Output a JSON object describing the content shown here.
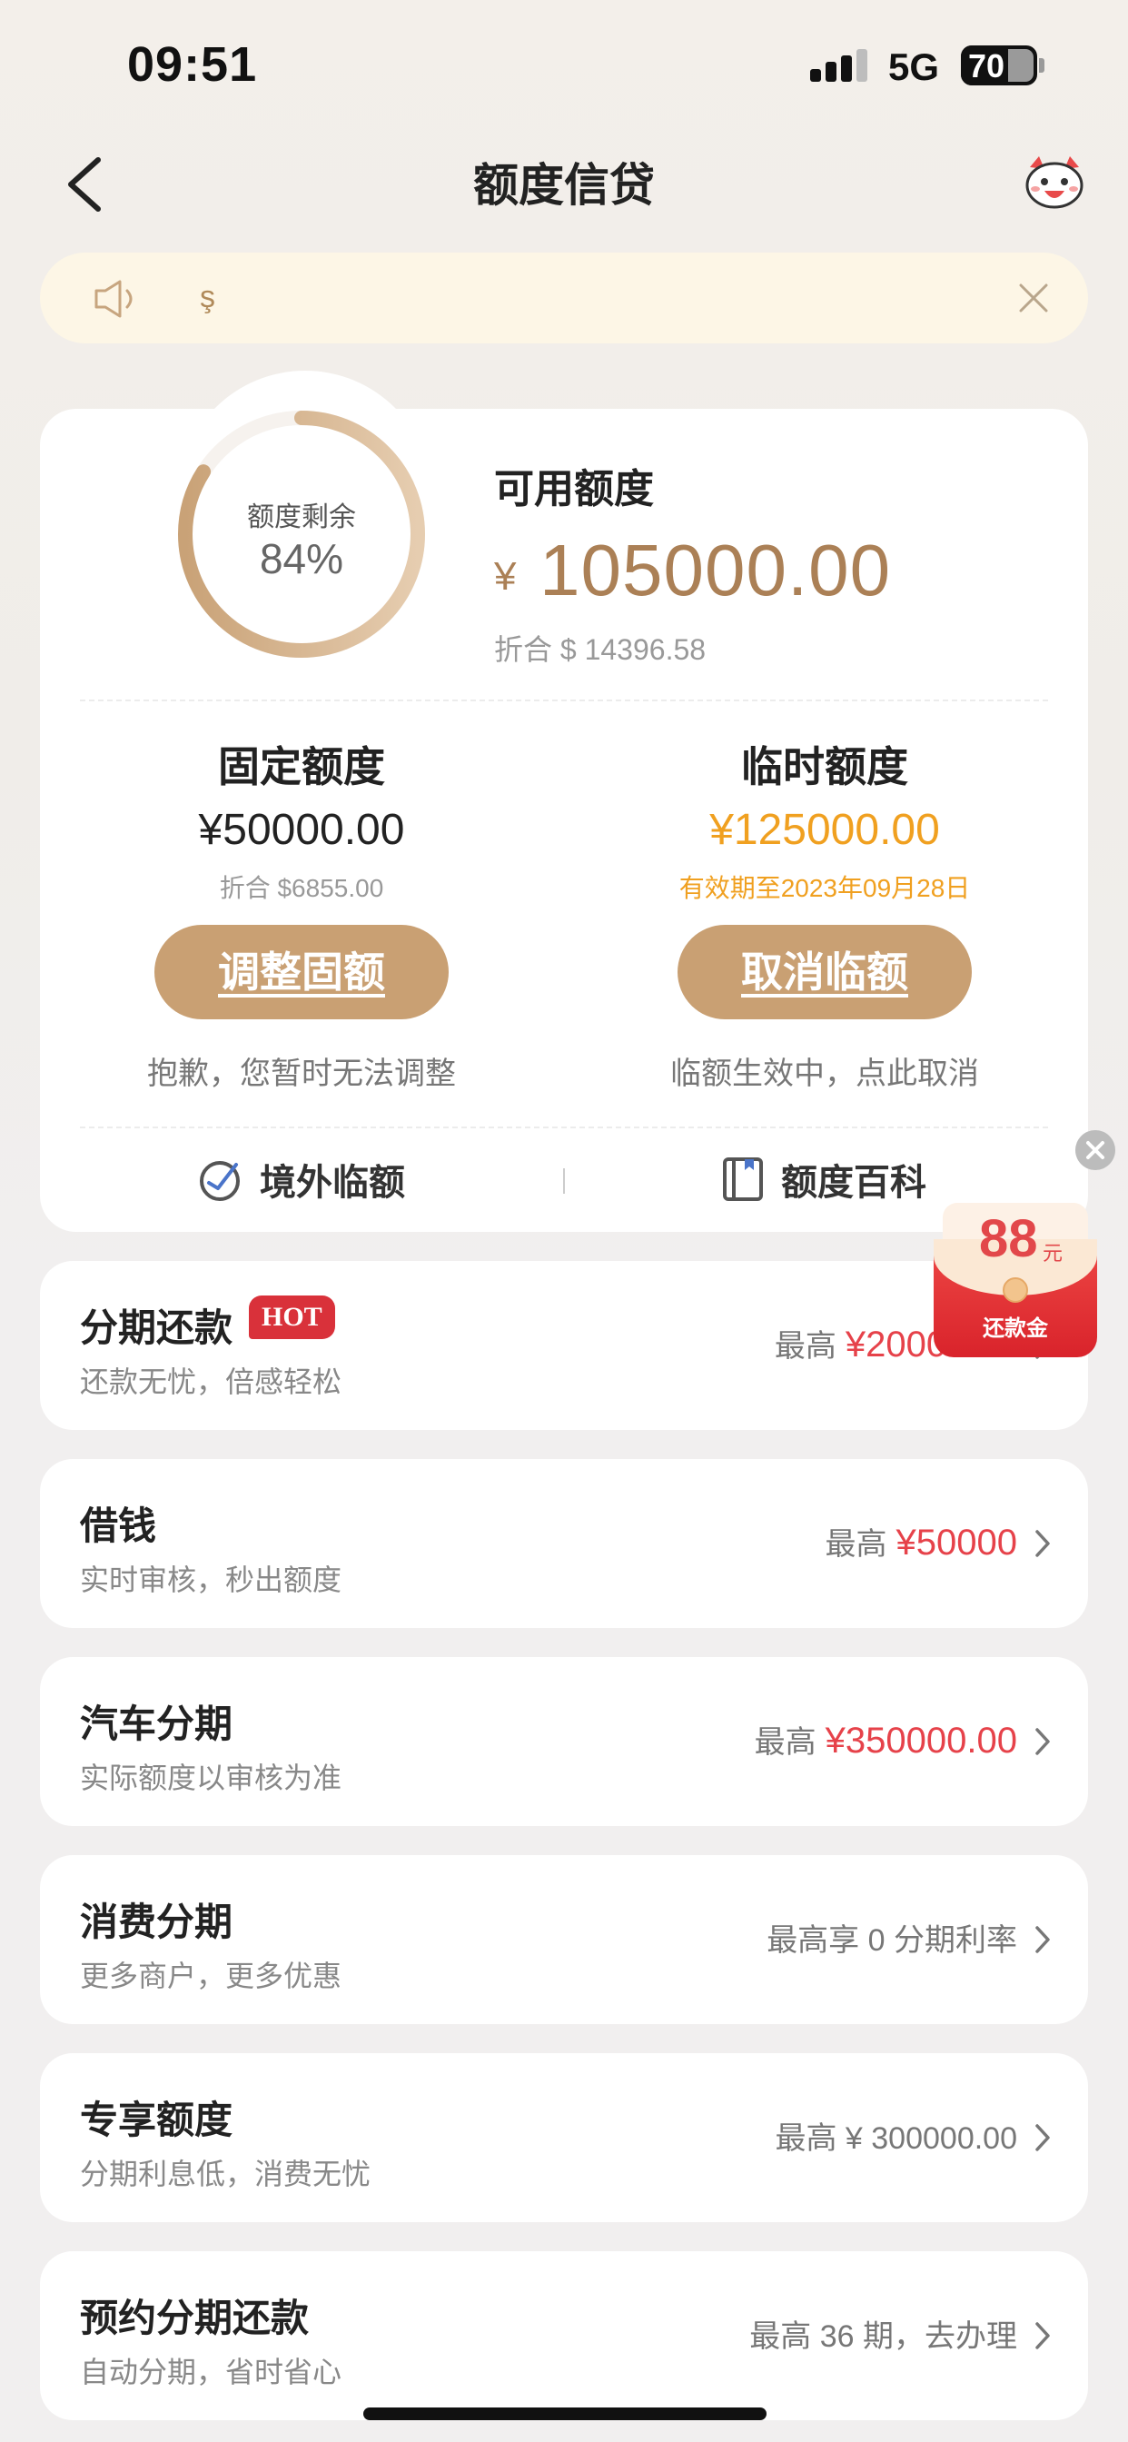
{
  "status_bar": {
    "time": "09:51",
    "network": "5G",
    "battery": "70",
    "battery_level": 0.7
  },
  "nav": {
    "title": "额度信贷",
    "back_icon": "chevron-left-icon",
    "mascot_icon": "mascot-icon"
  },
  "notice": {
    "text": "ş",
    "speaker_icon": "speaker-icon",
    "close_icon": "close-icon"
  },
  "credit": {
    "ring_label": "额度剩余",
    "ring_percent": "84%",
    "ring_fraction": 0.84,
    "available_label": "可用额度",
    "available_symbol": "¥",
    "available_amount": "105000.00",
    "available_converted": "折合 $ 14396.58",
    "fixed": {
      "title": "固定额度",
      "amount": "¥50000.00",
      "converted": "折合 $6855.00",
      "button": "调整固额",
      "note": "抱歉，您暂时无法调整"
    },
    "temporary": {
      "title": "临时额度",
      "amount": "¥125000.00",
      "valid": "有效期至2023年09月28日",
      "button": "取消临额",
      "note": "临额生效中，点此取消"
    },
    "links": [
      {
        "label": "境外临额",
        "icon": "overseas-credit-icon"
      },
      {
        "label": "额度百科",
        "icon": "book-icon"
      }
    ]
  },
  "products": [
    {
      "title": "分期还款",
      "badge": "HOT",
      "subtitle": "还款无忧，倍感轻松",
      "prefix": "最高",
      "amount": "¥20000.00"
    },
    {
      "title": "借钱",
      "subtitle": "实时审核，秒出额度",
      "prefix": "最高",
      "amount": "¥50000"
    },
    {
      "title": "汽车分期",
      "subtitle": "实际额度以审核为准",
      "prefix": "最高",
      "amount": "¥350000.00"
    },
    {
      "title": "消费分期",
      "subtitle": "更多商户，更多优惠",
      "prefix": "最高享 0 分期利率"
    },
    {
      "title": "专享额度",
      "subtitle": "分期利息低，消费无忧",
      "prefix": "最高 ¥ 300000.00"
    },
    {
      "title": "预约分期还款",
      "subtitle": "自动分期，省时省心",
      "prefix": "最高 36 期，去办理"
    }
  ],
  "red_packet": {
    "amount": "88",
    "unit": "元",
    "label": "还款金"
  },
  "colors": {
    "accent": "#c9a073",
    "gold_text": "#ab8056",
    "orange": "#f0a020",
    "red": "#e6424a"
  }
}
